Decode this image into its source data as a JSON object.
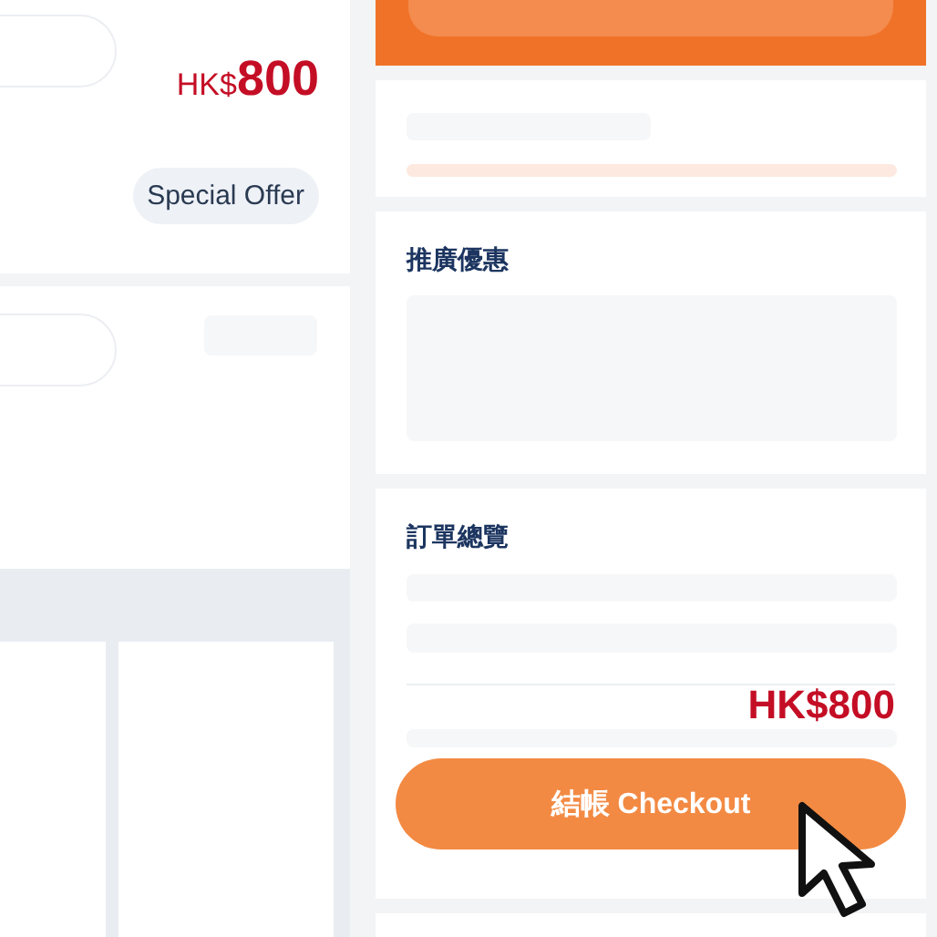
{
  "product": {
    "currency": "HK$",
    "price": "800",
    "badge": "Special Offer"
  },
  "promotions": {
    "title": "推廣優惠"
  },
  "order_summary": {
    "title": "訂單總覽",
    "total": "HK$800",
    "checkout_button": "結帳 Checkout"
  }
}
